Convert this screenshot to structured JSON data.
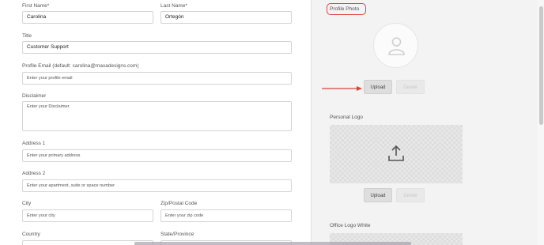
{
  "form": {
    "first_name": {
      "label": "First Name*",
      "value": "Carolina"
    },
    "last_name": {
      "label": "Last Name*",
      "value": "Ortegón"
    },
    "title": {
      "label": "Title",
      "value": "Customer Support"
    },
    "profile_email": {
      "label": "Profile Email (default: carolina@maxadesigns.com)",
      "placeholder": "Enter your profile email"
    },
    "disclaimer": {
      "label": "Disclaimer",
      "placeholder": "Enter your Disclaimer"
    },
    "address1": {
      "label": "Address 1",
      "placeholder": "Enter your primary address"
    },
    "address2": {
      "label": "Address 2",
      "placeholder": "Enter your apartment, suite or space number"
    },
    "city": {
      "label": "City",
      "placeholder": "Enter your city"
    },
    "zip": {
      "label": "Zip/Postal Code",
      "placeholder": "Enter your zip code"
    },
    "country": {
      "label": "Country"
    },
    "state": {
      "label": "State/Province"
    }
  },
  "right": {
    "profile_photo": {
      "label": "Profile Photo",
      "upload_label": "Upload",
      "delete_label": "Delete"
    },
    "personal_logo": {
      "label": "Personal Logo",
      "upload_label": "Upload",
      "delete_label": "Delete"
    },
    "office_logo_white": {
      "label": "Office Logo White"
    }
  },
  "icons": {
    "avatar": "user-avatar-icon",
    "upload": "upload-icon",
    "arrow": "red-arrow-icon"
  },
  "colors": {
    "highlight": "#d9443c",
    "page_bg": "#f2f2f2",
    "form_bg": "#ffffff"
  }
}
